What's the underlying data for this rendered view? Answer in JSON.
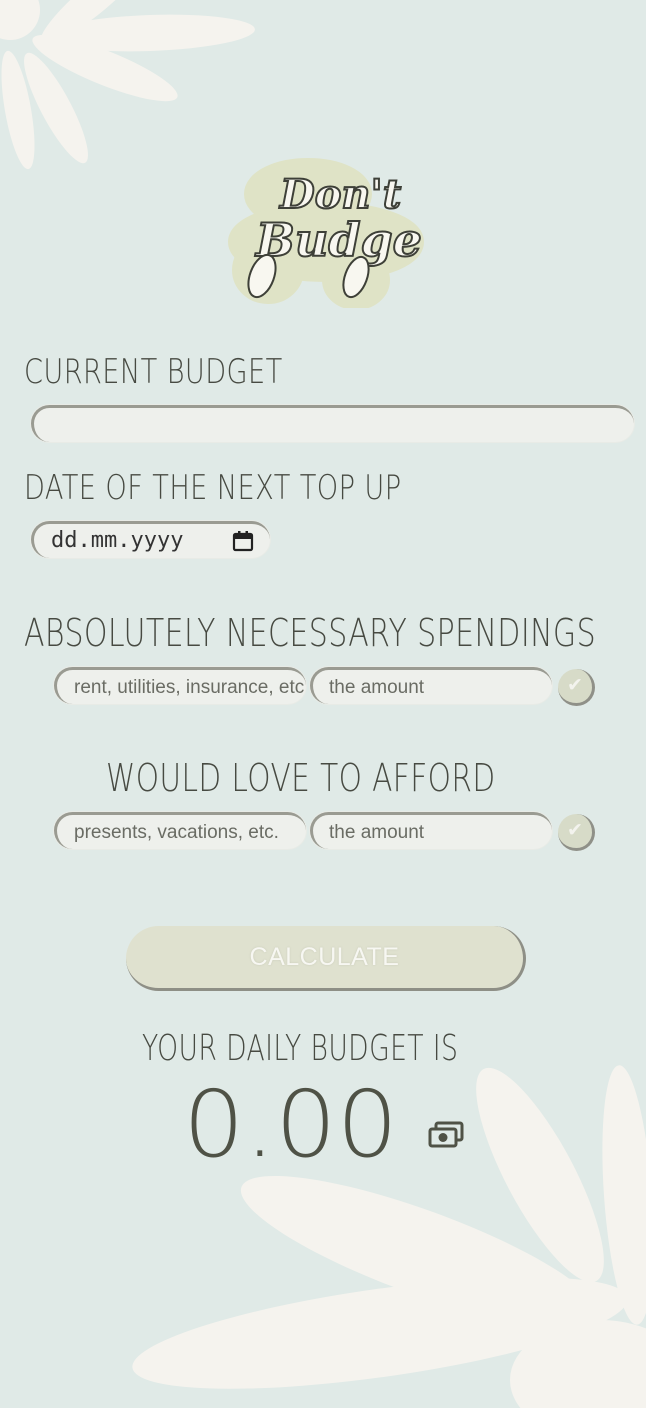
{
  "app": {
    "logo_text_line1": "Don't",
    "logo_text_line2": "Budge"
  },
  "colors": {
    "background": "#e0eae7",
    "petal": "#f5f3ee",
    "logo_glow": "#dfe3c6",
    "input_fill": "#eef0ec",
    "button_fill": "#dfe1cf",
    "text": "#474a42"
  },
  "budget": {
    "label": "CURRENT BUDGET",
    "value": ""
  },
  "top_up": {
    "label": "DATE OF THE NEXT TOP UP",
    "placeholder": "dd.mm.yyyy",
    "icon": "calendar-icon"
  },
  "necessary": {
    "label": "ABSOLUTELY NECESSARY SPENDINGS",
    "category_placeholder": "rent, utilities, insurance, etc.",
    "amount_placeholder": "the amount",
    "confirm_glyph": "✔",
    "confirm_icon": "check-icon"
  },
  "wishlist": {
    "label": "WOULD LOVE TO AFFORD",
    "category_placeholder": "presents, vacations, etc.",
    "amount_placeholder": "the amount",
    "confirm_glyph": "✔",
    "confirm_icon": "check-icon"
  },
  "calculate": {
    "label": "CALCULATE"
  },
  "result": {
    "label": "YOUR DAILY BUDGET IS",
    "value": "0.00",
    "icon": "money-icon"
  }
}
